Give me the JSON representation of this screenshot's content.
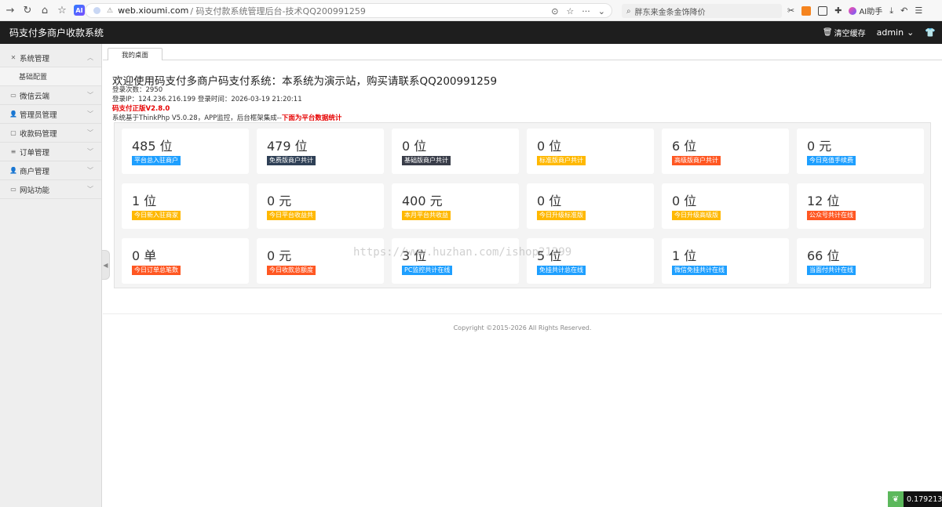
{
  "browser": {
    "url_host": "web.xioumi.com",
    "url_path": "/ 码支付款系统管理后台-技术QQ200991259",
    "search_placeholder": "胖东来金条金饰降价",
    "ai_helper_label": "AI助手"
  },
  "header": {
    "title": "码支付多商户收款系统",
    "clear_cache": "清空缓存",
    "user": "admin"
  },
  "sidebar": {
    "items": [
      {
        "label": "系统管理",
        "icon": "tools-icon"
      },
      {
        "label": "基础配置",
        "sub": true
      },
      {
        "label": "微信云端",
        "icon": "window-icon"
      },
      {
        "label": "管理员管理",
        "icon": "user-icon"
      },
      {
        "label": "收款码管理",
        "icon": "square-icon"
      },
      {
        "label": "订单管理",
        "icon": "list-icon"
      },
      {
        "label": "商户管理",
        "icon": "user-icon"
      },
      {
        "label": "网站功能",
        "icon": "window-icon"
      }
    ]
  },
  "tabs": {
    "home": "我的桌面"
  },
  "main": {
    "welcome": "欢迎使用码支付多商户码支付系统：本系统为演示站，购买请联系QQ200991259",
    "login_count": "登录次数：2950",
    "login_ip": "登录IP：124.236.216.199 登录时间：2026-03-19 21:20:11",
    "version": "码支付正版V2.8.0",
    "framework_prefix": "系统基于ThinkPhp V5.0.28，APP监控，后台框架集成--",
    "framework_red": "下面为平台数据统计"
  },
  "stats": [
    {
      "value": "485 位",
      "label": "平台总入驻商户",
      "color": "#1e9fff"
    },
    {
      "value": "479 位",
      "label": "免费版商户共计",
      "color": "#2f4056"
    },
    {
      "value": "0 位",
      "label": "基础版商户共计",
      "color": "#393d49"
    },
    {
      "value": "0 位",
      "label": "标准版商户共计",
      "color": "#ffb800"
    },
    {
      "value": "6 位",
      "label": "高级版商户共计",
      "color": "#ff5722"
    },
    {
      "value": "0 元",
      "label": "今日充值手续费",
      "color": "#1e9fff"
    },
    {
      "value": "1 位",
      "label": "今日新入驻商家",
      "color": "#ffb800"
    },
    {
      "value": "0 元",
      "label": "今日平台收益共",
      "color": "#ffb800"
    },
    {
      "value": "400 元",
      "label": "本月平台共收益",
      "color": "#ffb800"
    },
    {
      "value": "0 位",
      "label": "今日升级标准版",
      "color": "#ffb800"
    },
    {
      "value": "0 位",
      "label": "今日升级高级版",
      "color": "#ffb800"
    },
    {
      "value": "12 位",
      "label": "公众号共计在线",
      "color": "#ff5722"
    },
    {
      "value": "0 单",
      "label": "今日订单总笔数",
      "color": "#ff5722"
    },
    {
      "value": "0 元",
      "label": "今日收款总额度",
      "color": "#ff5722"
    },
    {
      "value": "3 位",
      "label": "PC监控共计在线",
      "color": "#1e9fff"
    },
    {
      "value": "5 位",
      "label": "免挂共计总在线",
      "color": "#1e9fff"
    },
    {
      "value": "1 位",
      "label": "微信免挂共计在线",
      "color": "#1e9fff"
    },
    {
      "value": "66 位",
      "label": "当面付共计在线",
      "color": "#1e9fff"
    }
  ],
  "footer": {
    "copyright": "Copyright ©2015-2026 All Rights Reserved."
  },
  "watermark": "https://www.huzhan.com/ishop21299",
  "timer": "0.179213s"
}
